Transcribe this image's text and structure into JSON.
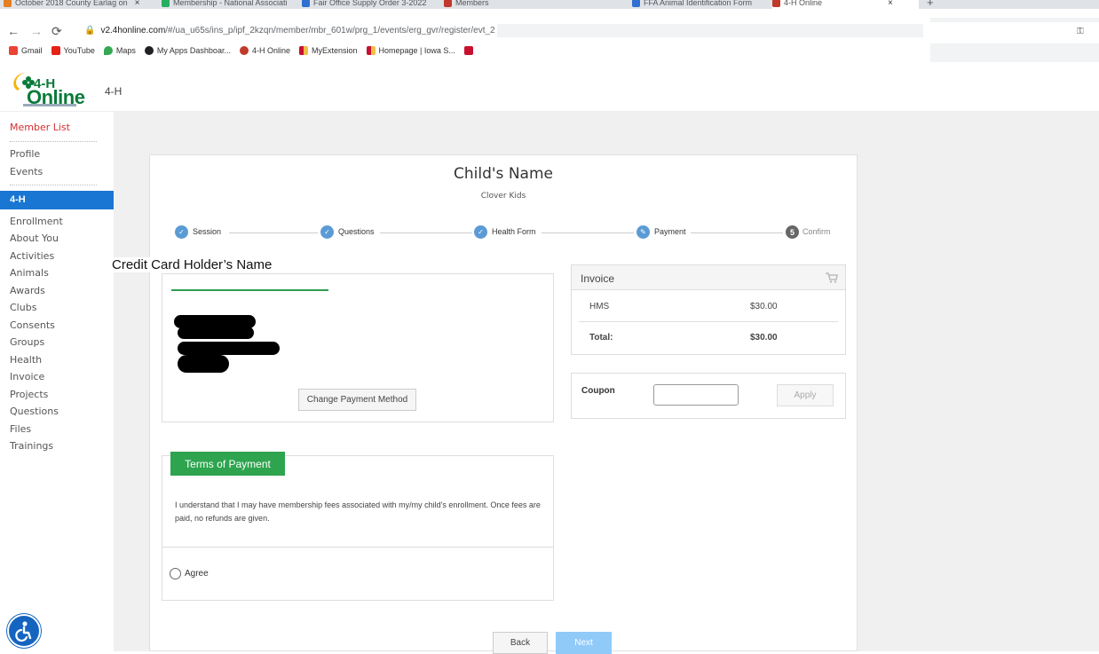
{
  "browser": {
    "tabs": [
      {
        "label": "October 2018 County Earlag on",
        "color": "#e67e22"
      },
      {
        "label": "Membership - National Associati",
        "color": "#27ae60"
      },
      {
        "label": "Fair Office Supply Order 3-2022",
        "color": "#2e6fd1"
      },
      {
        "label": "Members",
        "color": "#c0392b"
      },
      {
        "label": "FFA Animal Identification Form",
        "color": "#2e6fd1"
      },
      {
        "label": "4-H Online",
        "color": "#c0392b"
      }
    ],
    "url_host": "v2.4honline.com",
    "url_path": "/#/ua_u65s/ins_p/ipf_2kzqn/member/mbr_601w/prg_1/events/erg_gvr/register/evt_2",
    "bookmarks": [
      {
        "label": "Gmail",
        "color": "#ea4335"
      },
      {
        "label": "YouTube",
        "color": "#e62117"
      },
      {
        "label": "Maps",
        "color": "#34a853"
      },
      {
        "label": "My Apps Dashboar...",
        "color": "#202124"
      },
      {
        "label": "4-H Online",
        "color": "#c0392b"
      },
      {
        "label": "MyExtension",
        "color": "#c8102e"
      },
      {
        "label": "Homepage | Iowa S...",
        "color": "#c8102e"
      }
    ]
  },
  "header": {
    "logo_line1": "4-H",
    "logo_line2": "Online",
    "program": "4-H"
  },
  "sidebar": {
    "top_links": [
      "Member List"
    ],
    "links_a": [
      "Profile",
      "Events"
    ],
    "active": "4-H",
    "links_b": [
      "Enrollment",
      "About You",
      "Activities",
      "Animals",
      "Awards",
      "Clubs",
      "Consents",
      "Groups",
      "Health",
      "Invoice",
      "Projects",
      "Questions",
      "Files",
      "Trainings"
    ]
  },
  "page": {
    "title": "Child's Name",
    "subtitle": "Clover Kids",
    "overlay_label": "Credit Card Holder’s Name"
  },
  "steps": [
    {
      "label": "Session",
      "state": "done"
    },
    {
      "label": "Questions",
      "state": "done"
    },
    {
      "label": "Health Form",
      "state": "done"
    },
    {
      "label": "Payment",
      "state": "current"
    },
    {
      "label": "Confirm",
      "state": "todo",
      "number": "5"
    }
  ],
  "payment": {
    "change_button": "Change Payment Method"
  },
  "invoice": {
    "title": "Invoice",
    "item_name": "HMS",
    "item_amount": "$30.00",
    "total_label": "Total:",
    "total_amount": "$30.00"
  },
  "coupon": {
    "label": "Coupon",
    "value": "",
    "apply_label": "Apply"
  },
  "terms": {
    "heading": "Terms of Payment",
    "text": "I understand that I may have membership fees associated with my/my child's enrollment. Once fees are paid, no refunds are given.",
    "agree_label": "Agree"
  },
  "nav": {
    "back_label": "Back",
    "next_label": "Next"
  },
  "colors": {
    "accent_blue": "#1976d2",
    "step_blue": "#5b9bd5",
    "green": "#2ea44f",
    "red_link": "#d32f2f"
  }
}
